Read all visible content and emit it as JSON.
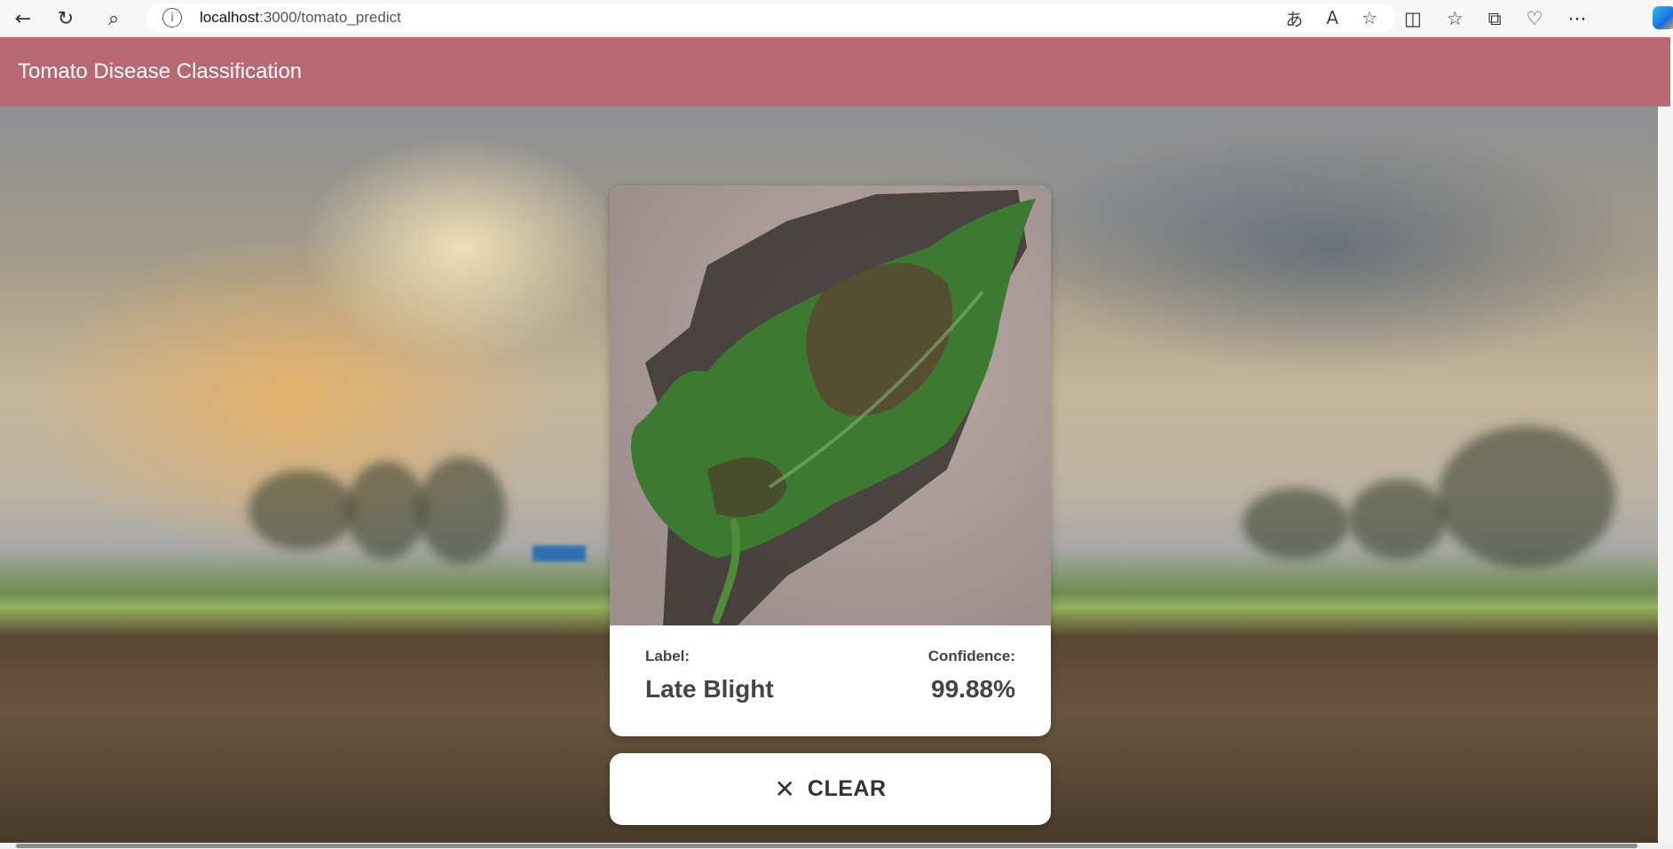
{
  "browser": {
    "back_icon": "arrow-left-icon",
    "reload_icon": "reload-icon",
    "search_icon": "search-icon",
    "url_host": "localhost",
    "url_path": ":3000/tomato_predict"
  },
  "app": {
    "title": "Tomato Disease Classification",
    "header_color": "#b86873"
  },
  "prediction": {
    "label_caption": "Label:",
    "label_value": "Late Blight",
    "confidence_caption": "Confidence:",
    "confidence_value": "99.88%"
  },
  "actions": {
    "clear_label": "CLEAR",
    "clear_icon": "close-icon"
  }
}
